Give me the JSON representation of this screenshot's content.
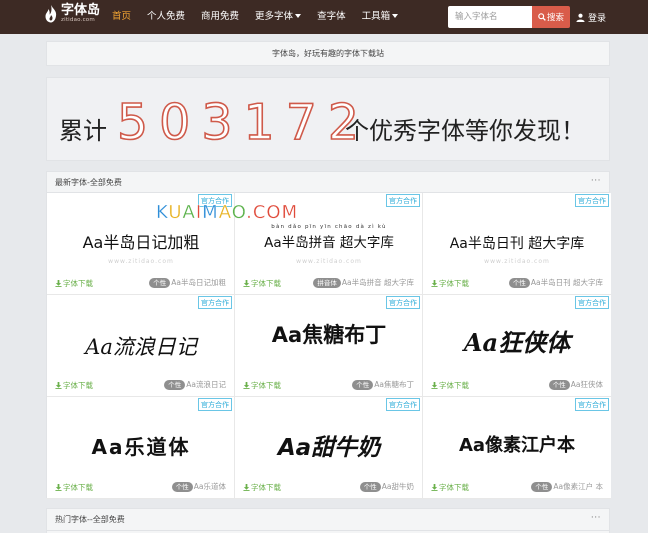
{
  "nav": {
    "logo_name": "字体岛",
    "logo_domain": "zitidao.com",
    "items": [
      {
        "label": "首页",
        "active": true
      },
      {
        "label": "个人免费"
      },
      {
        "label": "商用免费"
      },
      {
        "label": "更多字体"
      },
      {
        "label": "查字体"
      },
      {
        "label": "工具箱"
      }
    ],
    "search_placeholder": "输入字体名",
    "search_button": "搜索",
    "login": "登录"
  },
  "tagline": "字体岛，好玩有趣的字体下载站",
  "counter": {
    "prefix": "累计",
    "number": "503172",
    "suffix": "个优秀字体等你发现！"
  },
  "watermark_logo": "KUAIMAO.COM",
  "section_latest": {
    "title": "最新字体-全部免费",
    "more": "···",
    "cards": [
      {
        "badge": "官方合作",
        "sample": "Aa半岛日记加粗",
        "watermark": "www.zitidao.com",
        "download": "字体下载",
        "tag": "个性",
        "name": "Aa半岛日记加粗"
      },
      {
        "badge": "官方合作",
        "sample": "Aa半岛拼音 超大字库",
        "pinyin": "bàn dǎo pīn yīn chāo dà zì kù",
        "watermark": "www.zitidao.com",
        "download": "字体下载",
        "tag": "拼音体",
        "name": "Aa半岛拼音 超大字库"
      },
      {
        "badge": "官方合作",
        "sample": "Aa半岛日刊 超大字库",
        "watermark": "www.zitidao.com",
        "download": "字体下载",
        "tag": "个性",
        "name": "Aa半岛日刊 超大字库"
      },
      {
        "badge": "官方合作",
        "sample": "Aa流浪日记",
        "watermark": "",
        "download": "字体下载",
        "tag": "个性",
        "name": "Aa流浪日记"
      },
      {
        "badge": "官方合作",
        "sample": "Aa焦糖布丁",
        "watermark": "",
        "download": "字体下载",
        "tag": "个性",
        "name": "Aa焦糖布丁"
      },
      {
        "badge": "官方合作",
        "sample": "Aa狂侠体",
        "watermark": "",
        "download": "字体下载",
        "tag": "个性",
        "name": "Aa狂侠体"
      },
      {
        "badge": "官方合作",
        "sample": "Aa乐道体",
        "watermark": "",
        "download": "字体下载",
        "tag": "个性",
        "name": "Aa乐道体"
      },
      {
        "badge": "官方合作",
        "sample": "Aa甜牛奶",
        "watermark": "",
        "download": "字体下载",
        "tag": "个性",
        "name": "Aa甜牛奶"
      },
      {
        "badge": "官方合作",
        "sample": "Aa像素江户本",
        "watermark": "",
        "download": "字体下载",
        "tag": "个性",
        "name": "Aa像素江户 本"
      }
    ]
  },
  "section_hot": {
    "title": "热门字体--全部免费",
    "more": "···"
  },
  "colors": {
    "navbar": "#3d2a24",
    "nav_active": "#f3a532",
    "search_button": "#d95c4a",
    "counter_stroke": "#cf5a4a",
    "download_link": "#6ab04a",
    "badge": "#2eacd8"
  }
}
